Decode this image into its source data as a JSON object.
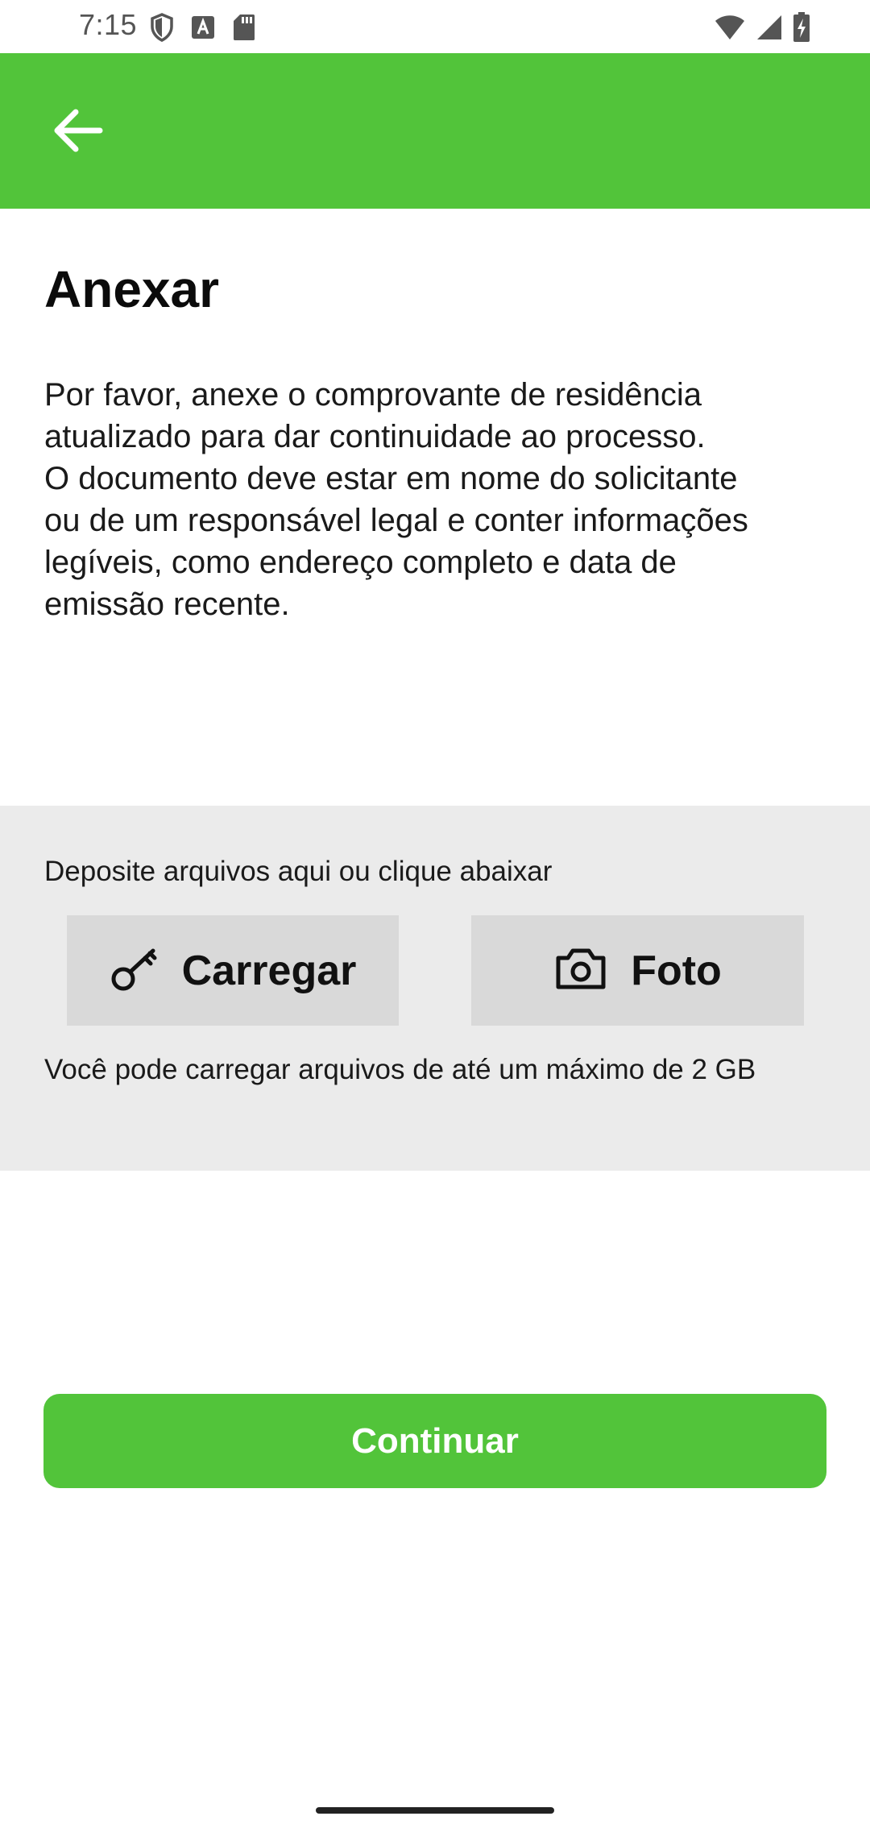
{
  "status_bar": {
    "time": "7:15",
    "left_icons": [
      "shield-icon",
      "font-a-icon",
      "sd-card-icon"
    ],
    "right_icons": [
      "wifi-icon",
      "cell-signal-icon",
      "battery-charging-icon"
    ]
  },
  "app_bar": {
    "back_icon": "arrow-left-icon",
    "color": "#52c43a"
  },
  "page": {
    "title": "Anexar",
    "description": "Por favor, anexe o comprovante de residência\natualizado para dar continuidade ao processo.\nO documento deve estar em nome do solicitante\nou de um responsável legal e conter informações\nlegíveis, como endereço completo e data de\nemissão recente."
  },
  "upload": {
    "hint": "Deposite arquivos aqui ou clique abaixar",
    "load_button_label": "Carregar",
    "load_button_icon": "key-icon",
    "photo_button_label": "Foto",
    "photo_button_icon": "camera-icon",
    "limit_text": "Você pode carregar arquivos de até um máximo de 2 GB"
  },
  "footer": {
    "continue_label": "Continuar"
  },
  "colors": {
    "accent": "#52c43a",
    "panel_bg": "#ebebeb",
    "button_bg": "#d9d9d9"
  }
}
